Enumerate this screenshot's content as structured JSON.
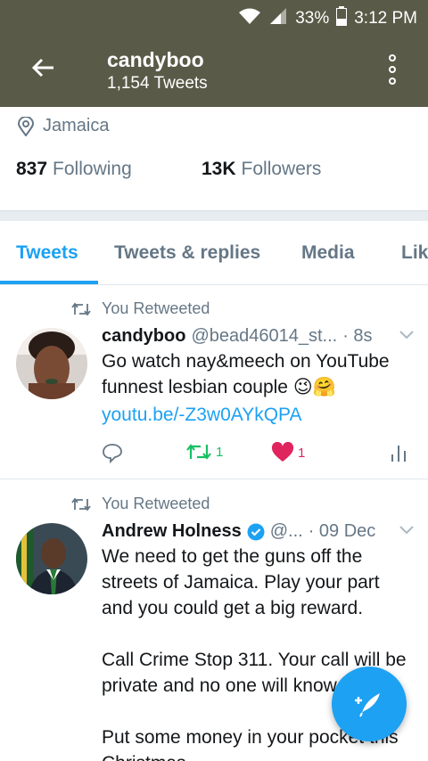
{
  "status_bar": {
    "battery_percent": "33%",
    "time": "3:12 PM",
    "icons": [
      "wifi-icon",
      "signal-icon",
      "battery-icon"
    ]
  },
  "header": {
    "title": "candyboo",
    "subtitle": "1,154 Tweets",
    "background_color": "#5a5a48"
  },
  "profile": {
    "location": "Jamaica",
    "following_count": "837",
    "following_label": "Following",
    "followers_count": "13K",
    "followers_label": "Followers"
  },
  "tabs": [
    {
      "label": "Tweets",
      "active": true
    },
    {
      "label": "Tweets & replies",
      "active": false
    },
    {
      "label": "Media",
      "active": false
    },
    {
      "label": "Lik",
      "active": false
    }
  ],
  "tweets": [
    {
      "retweet_label": "You Retweeted",
      "name": "candyboo",
      "handle": "@bead46014_st...",
      "time": "· 8s",
      "text": "Go watch nay&meech on YouTube funnest lesbian couple 😉🤗",
      "link": "youtu.be/-Z3w0AYkQPA",
      "retweets": "1",
      "likes": "1"
    },
    {
      "retweet_label": "You Retweeted",
      "name": "Andrew Holness",
      "verified": true,
      "handle": "@...",
      "time": "· 09 Dec",
      "text": "We need to get the guns off the streets of Jamaica. Play your part and you could get a big reward.\n\nCall Crime Stop 311. Your call will be private and no one will know.\n\nPut some money in your pocket this Christmas."
    }
  ],
  "colors": {
    "accent": "#1da1f2",
    "retweet_green": "#17bf63",
    "like_red": "#e0245e",
    "muted": "#657786"
  }
}
